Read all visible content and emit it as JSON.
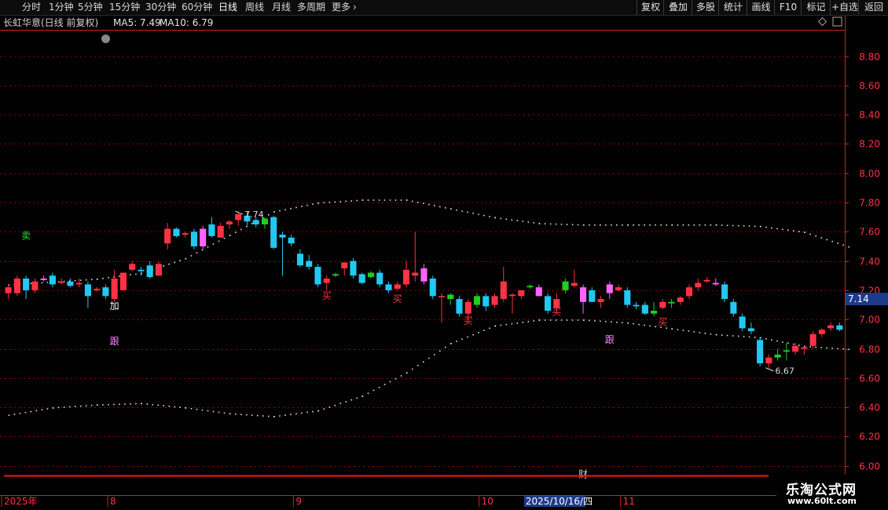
{
  "topbar": {
    "periods": [
      {
        "label": "分时",
        "active": false
      },
      {
        "label": "1分钟",
        "active": false
      },
      {
        "label": "5分钟",
        "active": false
      },
      {
        "label": "15分钟",
        "active": false
      },
      {
        "label": "30分钟",
        "active": false
      },
      {
        "label": "60分钟",
        "active": false
      },
      {
        "label": "日线",
        "active": true
      },
      {
        "label": "周线",
        "active": false
      },
      {
        "label": "月线",
        "active": false
      },
      {
        "label": "多周期",
        "active": false
      },
      {
        "label": "更多",
        "active": false
      }
    ],
    "right_buttons": [
      "复权",
      "叠加",
      "多股",
      "统计",
      "画线",
      "F10",
      "标记",
      "+自选",
      "返回"
    ]
  },
  "info": {
    "title": "长虹华意(日线 前复权)",
    "ma5": "MA5: 7.49",
    "ma10": "MA10: 6.79"
  },
  "colors": {
    "up": "#ff3344",
    "down": "#22c8f0",
    "green_candle": "#22cc22",
    "pink": "#ff66ff",
    "grid": "#8b0000",
    "axis": "#cc2222",
    "price_tag_bg": "#1e3a8a"
  },
  "chart_data": {
    "type": "candlestick",
    "ylim": [
      5.95,
      8.98
    ],
    "y_ticks": [
      "8.80",
      "8.60",
      "8.40",
      "8.20",
      "8.00",
      "7.80",
      "7.60",
      "7.40",
      "7.20",
      "7.00",
      "6.80",
      "6.60",
      "6.40",
      "6.20",
      "6.00"
    ],
    "current_price": "7.14",
    "x_labels": [
      {
        "label": "2025年",
        "index": 0
      },
      {
        "label": "8",
        "index": 12
      },
      {
        "label": "9",
        "index": 33
      },
      {
        "label": "10",
        "index": 54
      },
      {
        "label": "2025/10/16/四",
        "index": 59
      },
      {
        "label": "11",
        "index": 70
      }
    ],
    "candles": [
      {
        "o": 7.18,
        "h": 7.24,
        "l": 7.14,
        "c": 7.22
      },
      {
        "o": 7.18,
        "h": 7.3,
        "l": 7.16,
        "c": 7.28
      },
      {
        "o": 7.28,
        "h": 7.3,
        "l": 7.14,
        "c": 7.2
      },
      {
        "o": 7.2,
        "h": 7.28,
        "l": 7.18,
        "c": 7.26
      },
      {
        "o": 7.28,
        "h": 7.3,
        "l": 7.26,
        "c": 7.27,
        "style": "pink"
      },
      {
        "o": 7.3,
        "h": 7.32,
        "l": 7.22,
        "c": 7.24
      },
      {
        "o": 7.25,
        "h": 7.28,
        "l": 7.24,
        "c": 7.26
      },
      {
        "o": 7.26,
        "h": 7.28,
        "l": 7.22,
        "c": 7.23
      },
      {
        "o": 7.24,
        "h": 7.28,
        "l": 7.22,
        "c": 7.25
      },
      {
        "o": 7.24,
        "h": 7.26,
        "l": 7.08,
        "c": 7.16
      },
      {
        "o": 7.2,
        "h": 7.22,
        "l": 7.19,
        "c": 7.21
      },
      {
        "o": 7.22,
        "h": 7.24,
        "l": 7.14,
        "c": 7.16
      },
      {
        "o": 7.14,
        "h": 7.34,
        "l": 7.12,
        "c": 7.28
      },
      {
        "o": 7.2,
        "h": 7.32,
        "l": 7.2,
        "c": 7.32
      },
      {
        "o": 7.34,
        "h": 7.4,
        "l": 7.33,
        "c": 7.38
      },
      {
        "o": 7.34,
        "h": 7.36,
        "l": 7.3,
        "c": 7.33
      },
      {
        "o": 7.37,
        "h": 7.4,
        "l": 7.28,
        "c": 7.29
      },
      {
        "o": 7.3,
        "h": 7.4,
        "l": 7.3,
        "c": 7.38
      },
      {
        "o": 7.52,
        "h": 7.66,
        "l": 7.48,
        "c": 7.62
      },
      {
        "o": 7.62,
        "h": 7.63,
        "l": 7.56,
        "c": 7.57
      },
      {
        "o": 7.58,
        "h": 7.6,
        "l": 7.56,
        "c": 7.59
      },
      {
        "o": 7.6,
        "h": 7.62,
        "l": 7.48,
        "c": 7.5
      },
      {
        "o": 7.5,
        "h": 7.64,
        "l": 7.48,
        "c": 7.62,
        "style": "pink"
      },
      {
        "o": 7.65,
        "h": 7.7,
        "l": 7.56,
        "c": 7.57
      },
      {
        "o": 7.56,
        "h": 7.66,
        "l": 7.56,
        "c": 7.64
      },
      {
        "o": 7.65,
        "h": 7.68,
        "l": 7.62,
        "c": 7.67
      },
      {
        "o": 7.68,
        "h": 7.74,
        "l": 7.64,
        "c": 7.72
      },
      {
        "o": 7.71,
        "h": 7.74,
        "l": 7.64,
        "c": 7.67
      },
      {
        "o": 7.68,
        "h": 7.7,
        "l": 7.63,
        "c": 7.65
      },
      {
        "o": 7.65,
        "h": 7.7,
        "l": 7.62,
        "c": 7.69,
        "style": "green"
      },
      {
        "o": 7.7,
        "h": 7.71,
        "l": 7.48,
        "c": 7.49
      },
      {
        "o": 7.58,
        "h": 7.6,
        "l": 7.3,
        "c": 7.56
      },
      {
        "o": 7.56,
        "h": 7.58,
        "l": 7.5,
        "c": 7.52
      },
      {
        "o": 7.45,
        "h": 7.48,
        "l": 7.36,
        "c": 7.37
      },
      {
        "o": 7.4,
        "h": 7.44,
        "l": 7.34,
        "c": 7.36
      },
      {
        "o": 7.36,
        "h": 7.38,
        "l": 7.22,
        "c": 7.24
      },
      {
        "o": 7.25,
        "h": 7.3,
        "l": 7.2,
        "c": 7.28
      },
      {
        "o": 7.3,
        "h": 7.32,
        "l": 7.29,
        "c": 7.31,
        "style": "green"
      },
      {
        "o": 7.35,
        "h": 7.37,
        "l": 7.3,
        "c": 7.39
      },
      {
        "o": 7.4,
        "h": 7.42,
        "l": 7.28,
        "c": 7.3
      },
      {
        "o": 7.31,
        "h": 7.32,
        "l": 7.24,
        "c": 7.25
      },
      {
        "o": 7.29,
        "h": 7.33,
        "l": 7.28,
        "c": 7.32,
        "style": "green"
      },
      {
        "o": 7.32,
        "h": 7.34,
        "l": 7.22,
        "c": 7.24
      },
      {
        "o": 7.24,
        "h": 7.26,
        "l": 7.18,
        "c": 7.2
      },
      {
        "o": 7.21,
        "h": 7.26,
        "l": 7.2,
        "c": 7.24
      },
      {
        "o": 7.24,
        "h": 7.4,
        "l": 7.22,
        "c": 7.34
      },
      {
        "o": 7.3,
        "h": 7.6,
        "l": 7.26,
        "c": 7.32
      },
      {
        "o": 7.35,
        "h": 7.38,
        "l": 7.24,
        "c": 7.26,
        "style": "pink"
      },
      {
        "o": 7.28,
        "h": 7.3,
        "l": 7.14,
        "c": 7.16
      },
      {
        "o": 7.16,
        "h": 7.18,
        "l": 6.98,
        "c": 7.16
      },
      {
        "o": 7.14,
        "h": 7.18,
        "l": 7.1,
        "c": 7.17,
        "style": "green"
      },
      {
        "o": 7.14,
        "h": 7.16,
        "l": 7.02,
        "c": 7.04
      },
      {
        "o": 7.04,
        "h": 7.14,
        "l": 7.0,
        "c": 7.12
      },
      {
        "o": 7.16,
        "h": 7.18,
        "l": 7.08,
        "c": 7.1,
        "style": "green"
      },
      {
        "o": 7.16,
        "h": 7.18,
        "l": 7.06,
        "c": 7.09
      },
      {
        "o": 7.1,
        "h": 7.18,
        "l": 7.08,
        "c": 7.16
      },
      {
        "o": 7.14,
        "h": 7.36,
        "l": 7.12,
        "c": 7.26
      },
      {
        "o": 7.16,
        "h": 7.18,
        "l": 7.04,
        "c": 7.17
      },
      {
        "o": 7.16,
        "h": 7.2,
        "l": 7.14,
        "c": 7.2
      },
      {
        "o": 7.22,
        "h": 7.24,
        "l": 7.21,
        "c": 7.23,
        "style": "green"
      },
      {
        "o": 7.22,
        "h": 7.24,
        "l": 7.18,
        "c": 7.16,
        "style": "pink"
      },
      {
        "o": 7.16,
        "h": 7.18,
        "l": 7.04,
        "c": 7.06
      },
      {
        "o": 7.08,
        "h": 7.18,
        "l": 7.06,
        "c": 7.14
      },
      {
        "o": 7.2,
        "h": 7.28,
        "l": 7.18,
        "c": 7.26,
        "style": "green"
      },
      {
        "o": 7.23,
        "h": 7.34,
        "l": 7.22,
        "c": 7.25
      },
      {
        "o": 7.22,
        "h": 7.24,
        "l": 7.04,
        "c": 7.12,
        "style": "pink"
      },
      {
        "o": 7.2,
        "h": 7.22,
        "l": 7.12,
        "c": 7.12
      },
      {
        "o": 7.12,
        "h": 7.16,
        "l": 7.08,
        "c": 7.14
      },
      {
        "o": 7.18,
        "h": 7.26,
        "l": 7.14,
        "c": 7.24,
        "style": "pink"
      },
      {
        "o": 7.2,
        "h": 7.24,
        "l": 7.19,
        "c": 7.22
      },
      {
        "o": 7.2,
        "h": 7.22,
        "l": 7.08,
        "c": 7.1
      },
      {
        "o": 7.1,
        "h": 7.12,
        "l": 7.07,
        "c": 7.09
      },
      {
        "o": 7.1,
        "h": 7.12,
        "l": 7.03,
        "c": 7.04
      },
      {
        "o": 7.06,
        "h": 7.12,
        "l": 7.02,
        "c": 7.04,
        "style": "green"
      },
      {
        "o": 7.08,
        "h": 7.14,
        "l": 7.07,
        "c": 7.12
      },
      {
        "o": 7.11,
        "h": 7.14,
        "l": 7.08,
        "c": 7.12,
        "style": "green"
      },
      {
        "o": 7.12,
        "h": 7.16,
        "l": 7.1,
        "c": 7.15
      },
      {
        "o": 7.16,
        "h": 7.24,
        "l": 7.14,
        "c": 7.22
      },
      {
        "o": 7.22,
        "h": 7.28,
        "l": 7.2,
        "c": 7.25
      },
      {
        "o": 7.26,
        "h": 7.29,
        "l": 7.25,
        "c": 7.27
      },
      {
        "o": 7.24,
        "h": 7.28,
        "l": 7.23,
        "c": 7.25,
        "style": "pink"
      },
      {
        "o": 7.24,
        "h": 7.26,
        "l": 7.12,
        "c": 7.14
      },
      {
        "o": 7.12,
        "h": 7.14,
        "l": 7.02,
        "c": 7.04
      },
      {
        "o": 7.02,
        "h": 7.04,
        "l": 6.92,
        "c": 6.94
      },
      {
        "o": 6.94,
        "h": 6.98,
        "l": 6.9,
        "c": 6.92
      },
      {
        "o": 6.86,
        "h": 6.88,
        "l": 6.68,
        "c": 6.7
      },
      {
        "o": 6.7,
        "h": 6.76,
        "l": 6.67,
        "c": 6.74
      },
      {
        "o": 6.76,
        "h": 6.8,
        "l": 6.72,
        "c": 6.74,
        "style": "green"
      },
      {
        "o": 6.78,
        "h": 6.84,
        "l": 6.72,
        "c": 6.79,
        "style": "green"
      },
      {
        "o": 6.78,
        "h": 6.84,
        "l": 6.76,
        "c": 6.82
      },
      {
        "o": 6.8,
        "h": 6.82,
        "l": 6.76,
        "c": 6.81
      },
      {
        "o": 6.82,
        "h": 6.92,
        "l": 6.8,
        "c": 6.9
      },
      {
        "o": 6.9,
        "h": 6.94,
        "l": 6.88,
        "c": 6.93
      },
      {
        "o": 6.94,
        "h": 6.98,
        "l": 6.92,
        "c": 6.96
      },
      {
        "o": 6.96,
        "h": 6.98,
        "l": 6.92,
        "c": 6.93
      }
    ],
    "upper_band_x": [
      0,
      5,
      10,
      15,
      20,
      25,
      30,
      35,
      40,
      45,
      50,
      55,
      60,
      65,
      70,
      75,
      80,
      85,
      90,
      95
    ],
    "upper_band_y": [
      7.24,
      7.26,
      7.28,
      7.32,
      7.42,
      7.58,
      7.74,
      7.8,
      7.82,
      7.82,
      7.76,
      7.7,
      7.66,
      7.65,
      7.65,
      7.65,
      7.65,
      7.64,
      7.6,
      7.5
    ],
    "lower_band_x": [
      0,
      5,
      10,
      15,
      20,
      25,
      30,
      35,
      40,
      45,
      50,
      55,
      60,
      65,
      70,
      75,
      80,
      85,
      90,
      95
    ],
    "lower_band_y": [
      6.35,
      6.4,
      6.42,
      6.43,
      6.4,
      6.36,
      6.34,
      6.38,
      6.48,
      6.64,
      6.84,
      6.96,
      7.0,
      7.0,
      6.98,
      6.94,
      6.9,
      6.88,
      6.82,
      6.8
    ],
    "signals": [
      {
        "text": "卖",
        "index": 2,
        "price": 7.55,
        "color": "#33dd33"
      },
      {
        "text": "加",
        "index": 12,
        "price": 7.07,
        "color": "#ffffff"
      },
      {
        "text": "跟",
        "index": 12,
        "price": 6.83,
        "color": "#ff88ff"
      },
      {
        "text": "买",
        "index": 36,
        "price": 7.14,
        "color": "#ff3344"
      },
      {
        "text": "买",
        "index": 44,
        "price": 7.12,
        "color": "#ff3344"
      },
      {
        "text": "买",
        "index": 52,
        "price": 6.97,
        "color": "#ff3344"
      },
      {
        "text": "买",
        "index": 62,
        "price": 7.03,
        "color": "#ff3344"
      },
      {
        "text": "跟",
        "index": 68,
        "price": 6.84,
        "color": "#ff88ff"
      },
      {
        "text": "买",
        "index": 74,
        "price": 6.96,
        "color": "#ff3344"
      },
      {
        "text": "财",
        "index": 65,
        "price": 5.92,
        "color": "#cccccc"
      }
    ],
    "price_annotations": [
      {
        "text": "7.74",
        "index": 26,
        "price": 7.74
      },
      {
        "text": "6.67",
        "index": 86,
        "price": 6.67
      }
    ]
  },
  "watermark": {
    "line1": "乐淘公式网",
    "line2": "www.60lt.com"
  }
}
